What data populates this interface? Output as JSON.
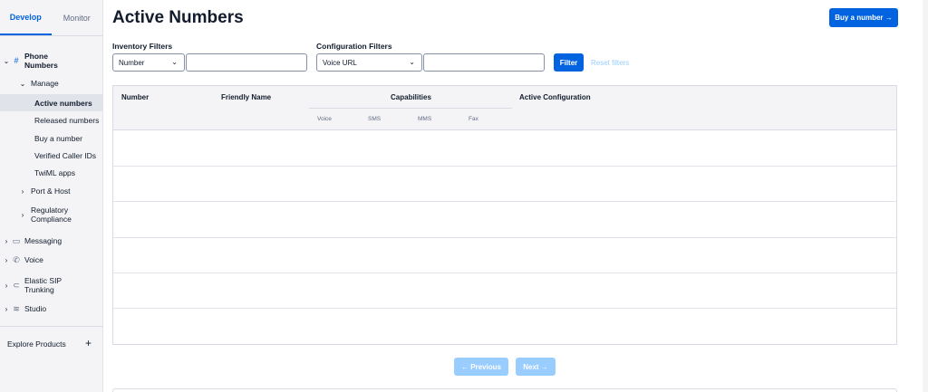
{
  "sidebar": {
    "tabs": [
      {
        "label": "Develop",
        "active": true
      },
      {
        "label": "Monitor",
        "active": false
      }
    ],
    "phone_numbers": "Phone\nNumbers",
    "phone_numbers_icon": "hash-icon",
    "manage": "Manage",
    "items": [
      {
        "label": "Active numbers",
        "active": true
      },
      {
        "label": "Released numbers"
      },
      {
        "label": "Buy a number"
      },
      {
        "label": "Verified Caller IDs"
      },
      {
        "label": "TwiML apps"
      }
    ],
    "port_host": "Port & Host",
    "regulatory": "Regulatory\nCompliance",
    "messaging": "Messaging",
    "voice": "Voice",
    "elastic_sip": "Elastic SIP\nTrunking",
    "studio": "Studio",
    "explore": "Explore Products",
    "explore_plus": "+"
  },
  "main": {
    "title": "Active Numbers",
    "buy_button": "Buy a number →",
    "inventory_label": "Inventory Filters",
    "inventory_select": "Number",
    "inventory_input": "",
    "config_label": "Configuration Filters",
    "config_select": "Voice URL",
    "config_input": "",
    "filter_button": "Filter",
    "reset_filters": "Reset filters"
  },
  "table": {
    "headers": {
      "number": "Number",
      "friendly_name": "Friendly Name",
      "capabilities": "Capabilities",
      "active_configuration": "Active Configuration"
    },
    "capability_subheaders": [
      "Voice",
      "SMS",
      "MMS",
      "Fax"
    ],
    "rows": []
  },
  "pagination": {
    "previous": "← Previous",
    "next": "Next →"
  },
  "colors": {
    "primary": "#0263e0",
    "disabled": "#99cdff",
    "text": "#121c2d",
    "sidebar_bg": "#f4f4f6"
  }
}
